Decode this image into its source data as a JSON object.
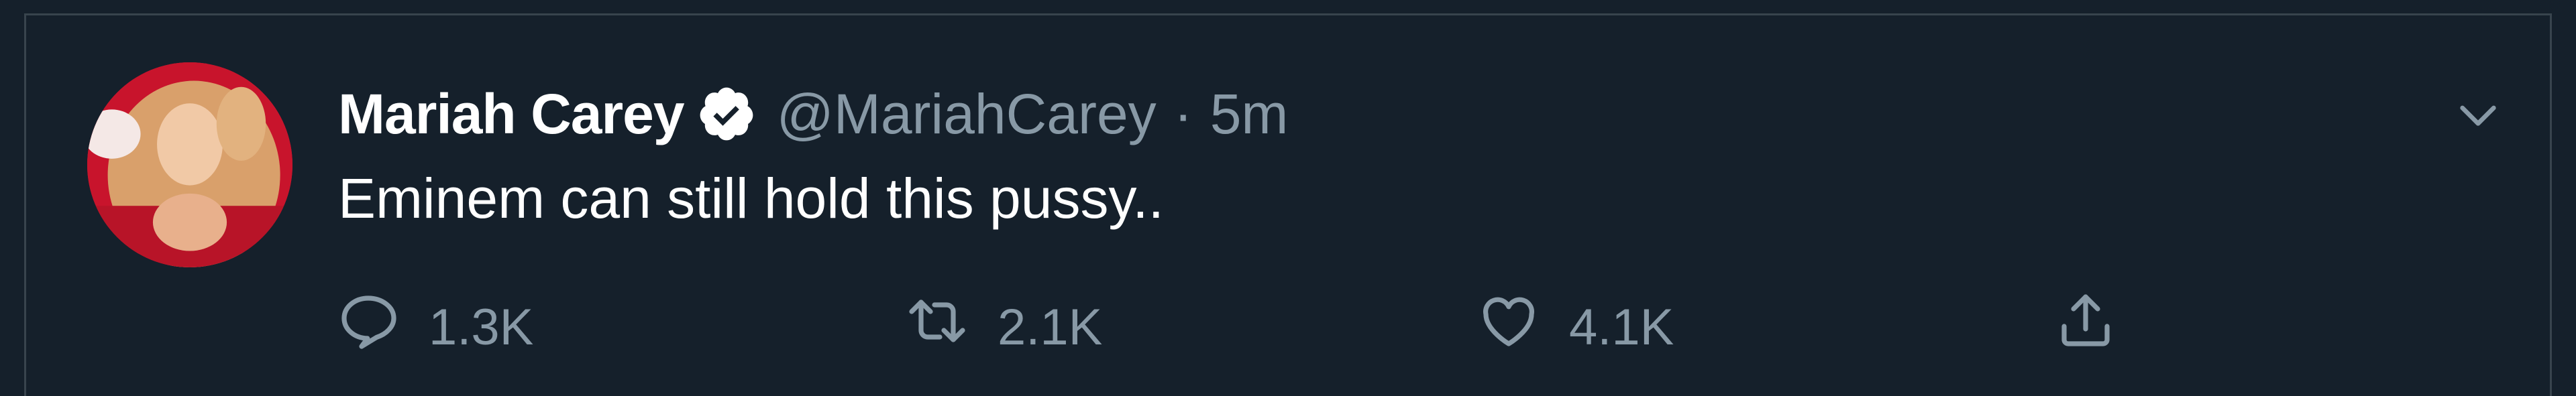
{
  "tweet": {
    "author_name": "Mariah Carey",
    "handle": "@MariahCarey",
    "separator": "·",
    "time": "5m",
    "text": "Eminem can still hold this pussy..",
    "actions": {
      "reply_count": "1.3K",
      "retweet_count": "2.1K",
      "like_count": "4.1K"
    },
    "icons": {
      "verified": "verified-badge-icon",
      "more": "chevron-down-icon",
      "reply": "reply-icon",
      "retweet": "retweet-icon",
      "like": "heart-icon",
      "share": "share-icon"
    }
  },
  "colors": {
    "background": "#15202b",
    "border": "#38444d",
    "primary_text": "#ffffff",
    "secondary_text": "#8899a6"
  }
}
